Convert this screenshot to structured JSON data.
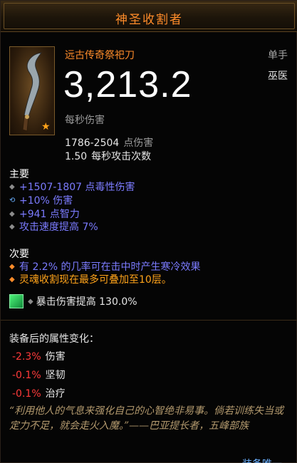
{
  "title": "神圣收割者",
  "item": {
    "type": "远古传奇祭祀刀",
    "slot": "单手",
    "class_req": "巫医",
    "dps": "3,213.2",
    "dps_label": "每秒伤害",
    "damage_range": "1786-2504",
    "damage_unit": "点伤害",
    "attack_speed": "1.50",
    "attack_speed_unit": "每秒攻击次数"
  },
  "primary": {
    "heading": "主要",
    "affixes": [
      {
        "text": "+1507-1807 点毒性伤害",
        "bullet": "gray"
      },
      {
        "text": "+10% 伤害",
        "bullet": "blue"
      },
      {
        "text": "+941 点智力",
        "bullet": "gray"
      },
      {
        "text": "攻击速度提高 7%",
        "bullet": "gray"
      }
    ]
  },
  "secondary": {
    "heading": "次要",
    "affixes": [
      {
        "text": "有 2.2% 的几率可在击中时产生寒冷效果",
        "bullet": "orange"
      },
      {
        "text": "灵魂收割现在最多可叠加至10层。",
        "bullet": "orange"
      }
    ]
  },
  "socket": {
    "text": "暴击伤害提高 130.0%"
  },
  "changes": {
    "title": "装备后的属性变化：",
    "rows": [
      {
        "value": "-2.3%",
        "label": "伤害"
      },
      {
        "value": "-0.1%",
        "label": "坚韧"
      },
      {
        "value": "-0.1%",
        "label": "治疗"
      }
    ]
  },
  "flavor": "“利用他人的气息来强化自己的心智绝非易事。倘若训练失当或定力不足，就会走火入魔。”——巴亚提长者，五峰部族",
  "equipped_label": "装备唯一",
  "colors": {
    "legendary": "#ff8c2a",
    "magic": "#7b7bff",
    "negative": "#ff3a3a"
  }
}
